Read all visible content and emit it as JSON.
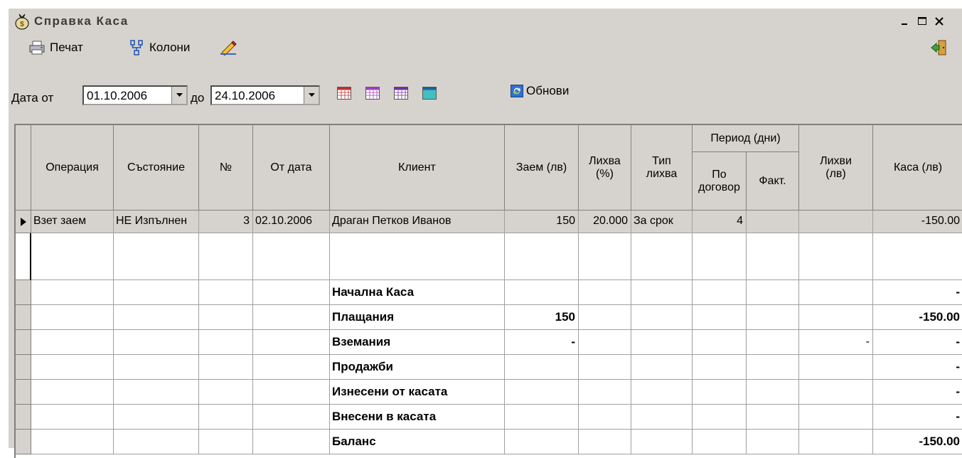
{
  "window": {
    "title": "Справка Каса",
    "minimize": "_",
    "maximize": "□",
    "close": "×"
  },
  "toolbar": {
    "print_label": "Печат",
    "columns_label": "Колони"
  },
  "filter": {
    "date_from_label": "Дата от",
    "date_from": "01.10.2006",
    "date_to_label": "до",
    "date_to": "24.10.2006",
    "refresh_label": "Обнови"
  },
  "headers": {
    "operation": "Операция",
    "status": "Състояние",
    "number": "№",
    "from_date": "От дата",
    "client": "Клиент",
    "loan": "Заем (лв)",
    "interest_pct": "Лихва (%)",
    "interest_type": "Тип лихва",
    "period": "Период (дни)",
    "period_contract": "По договор",
    "period_actual": "Факт.",
    "interests_bgn": "Лихви (лв)",
    "cash": "Каса (лв)"
  },
  "rows": [
    {
      "operation": "Взет заем",
      "status": "НЕ Изпълнен",
      "number": "3",
      "from_date": "02.10.2006",
      "client": "Драган Петков Иванов",
      "loan": "150",
      "interest_pct": "20.000",
      "interest_type": "За срок",
      "period_contract": "4",
      "period_actual": "",
      "interests_bgn": "",
      "cash": "-150.00"
    }
  ],
  "summary": [
    {
      "label": "Начална Каса",
      "loan": "",
      "interests": "",
      "cash": "-"
    },
    {
      "label": "Плащания",
      "loan": "150",
      "interests": "",
      "cash": "-150.00"
    },
    {
      "label": "Вземания",
      "loan": "-",
      "interests": "-",
      "cash": "-"
    },
    {
      "label": "Продажби",
      "loan": "",
      "interests": "",
      "cash": "-"
    },
    {
      "label": "Изнесени от касата",
      "loan": "",
      "interests": "",
      "cash": "-"
    },
    {
      "label": "Внесени в касата",
      "loan": "",
      "interests": "",
      "cash": "-"
    },
    {
      "label": "Баланс",
      "loan": "",
      "interests": "",
      "cash": "-150.00"
    }
  ]
}
